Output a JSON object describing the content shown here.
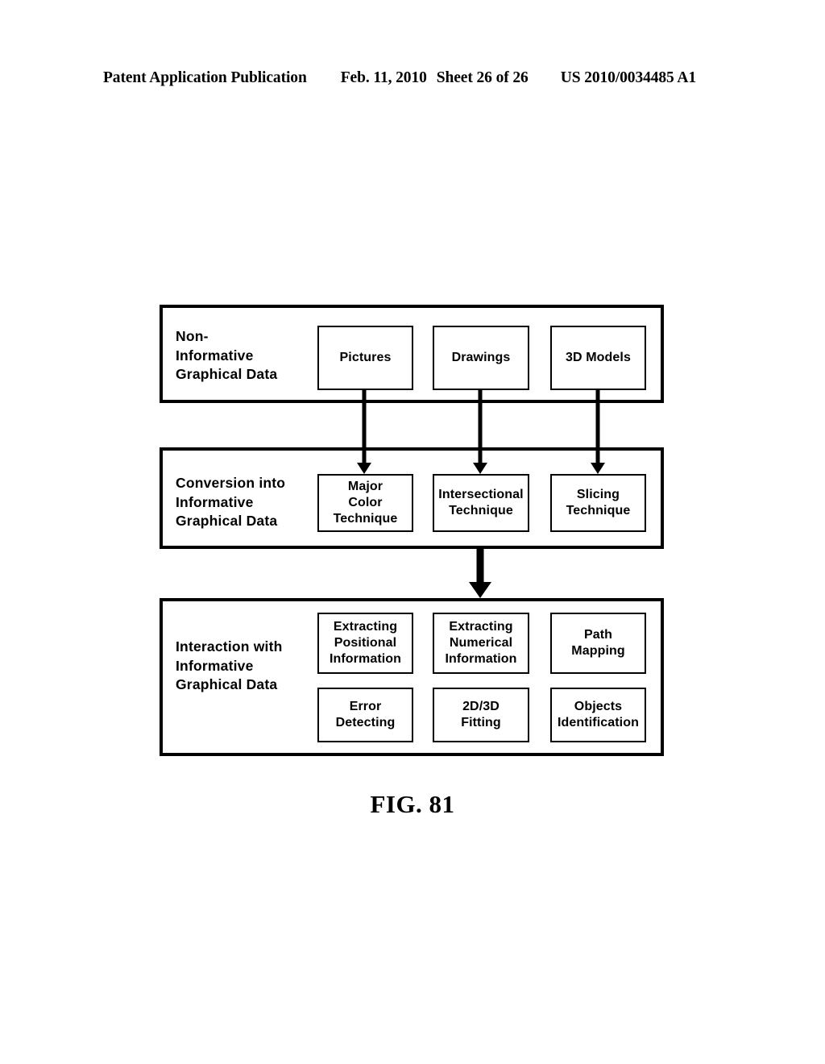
{
  "header": {
    "publication": "Patent Application Publication",
    "date": "Feb. 11, 2010",
    "sheet": "Sheet 26 of 26",
    "patent_number": "US 2010/0034485 A1"
  },
  "figure": {
    "caption": "FIG. 81",
    "groups": [
      {
        "id": "non-informative-graphical-data",
        "label": "Non-\nInformative\nGraphical Data",
        "nodes": [
          {
            "id": "pictures",
            "label": "Pictures"
          },
          {
            "id": "drawings",
            "label": "Drawings"
          },
          {
            "id": "3d-models",
            "label": "3D Models"
          }
        ]
      },
      {
        "id": "conversion-into-informative-graphical-data",
        "label": "Conversion into\nInformative\nGraphical Data",
        "nodes": [
          {
            "id": "major-color-technique",
            "label": "Major\nColor\nTechnique"
          },
          {
            "id": "intersectional-technique",
            "label": "Intersectional\nTechnique"
          },
          {
            "id": "slicing-technique",
            "label": "Slicing\nTechnique"
          }
        ]
      },
      {
        "id": "interaction-with-informative-graphical-data",
        "label": "Interaction with\nInformative\nGraphical Data",
        "nodes": [
          {
            "id": "extracting-positional-information",
            "label": "Extracting\nPositional\nInformation"
          },
          {
            "id": "extracting-numerical-information",
            "label": "Extracting\nNumerical\nInformation"
          },
          {
            "id": "path-mapping",
            "label": "Path\nMapping"
          },
          {
            "id": "error-detecting",
            "label": "Error\nDetecting"
          },
          {
            "id": "2d-3d-fitting",
            "label": "2D/3D\nFitting"
          },
          {
            "id": "objects-identification",
            "label": "Objects\nIdentification"
          }
        ]
      }
    ],
    "connectors": [
      {
        "id": "pictures-to-major-color",
        "style": "thin"
      },
      {
        "id": "drawings-to-intersectional",
        "style": "thin"
      },
      {
        "id": "3d-models-to-slicing",
        "style": "thin"
      },
      {
        "id": "conversion-to-interaction",
        "style": "thick"
      }
    ]
  },
  "colors": {
    "ink": "#000000",
    "paper": "#ffffff"
  }
}
